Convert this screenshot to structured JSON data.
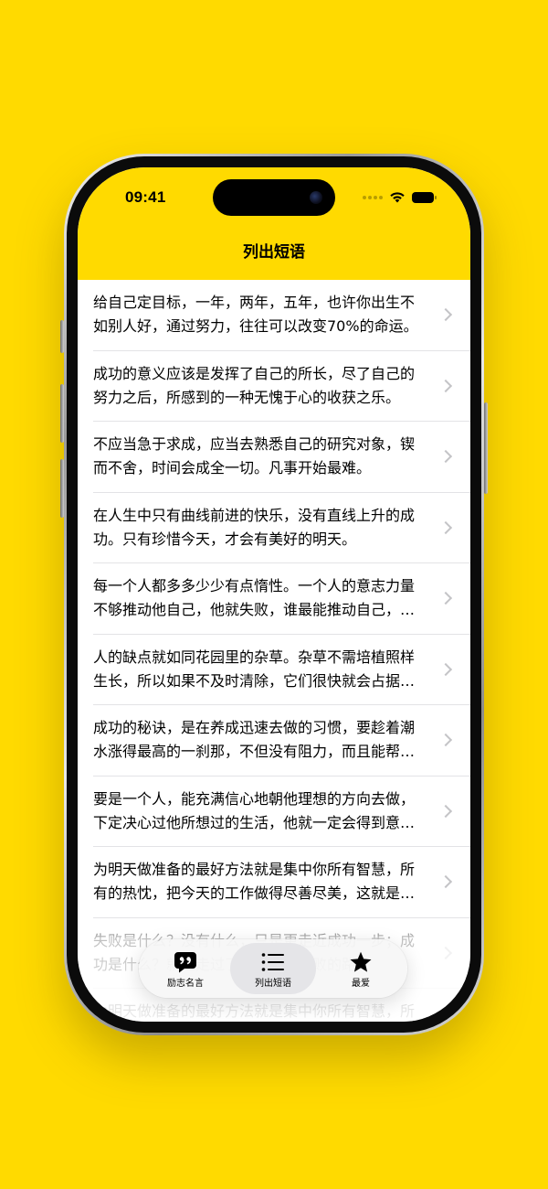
{
  "status_bar": {
    "time": "09:41"
  },
  "nav": {
    "title": "列出短语"
  },
  "phrases": [
    "给自己定目标，一年，两年，五年，也许你出生不如别人好，通过努力，往往可以改变70%的命运。",
    "成功的意义应该是发挥了自己的所长，尽了自己的努力之后，所感到的一种无愧于心的收获之乐。",
    "不应当急于求成，应当去熟悉自己的研究对象，锲而不舍，时间会成全一切。凡事开始最难。",
    "在人生中只有曲线前进的快乐，没有直线上升的成功。只有珍惜今天，才会有美好的明天。",
    "每一个人都多多少少有点惰性。一个人的意志力量不够推动他自己，他就失败，谁最能推动自己，谁就先得到成功。",
    "人的缺点就如同花园里的杂草。杂草不需培植照样生长，所以如果不及时清除，它们很快就会占据整个花园。",
    "成功的秘诀，是在养成迅速去做的习惯，要趁着潮水涨得最高的一刹那，不但没有阻力，而且能帮助你迅速地成功。",
    "要是一个人，能充满信心地朝他理想的方向去做，下定决心过他所想过的生活，他就一定会得到意外的成功。",
    "为明天做准备的最好方法就是集中你所有智慧，所有的热忱，把今天的工作做得尽善尽美，这就是你能应付未来的唯一方法。",
    "失败是什么？没有什么，只是更走近成功一步；成功是什么？就是走过了所有通向失败的路。",
    "为明天做准备的最好方法就是集中你所有智慧，所有的热忱，把今天的工作做得尽善尽美。"
  ],
  "tabs": [
    {
      "label": "励志名言",
      "icon": "quote-bubble-icon",
      "active": false
    },
    {
      "label": "列出短语",
      "icon": "list-icon",
      "active": true
    },
    {
      "label": "最爱",
      "icon": "star-icon",
      "active": false
    }
  ],
  "colors": {
    "background": "#FFDA00",
    "header": "#FFDA00",
    "chevron": "#C4C4C7",
    "divider": "#E3E3E6"
  }
}
